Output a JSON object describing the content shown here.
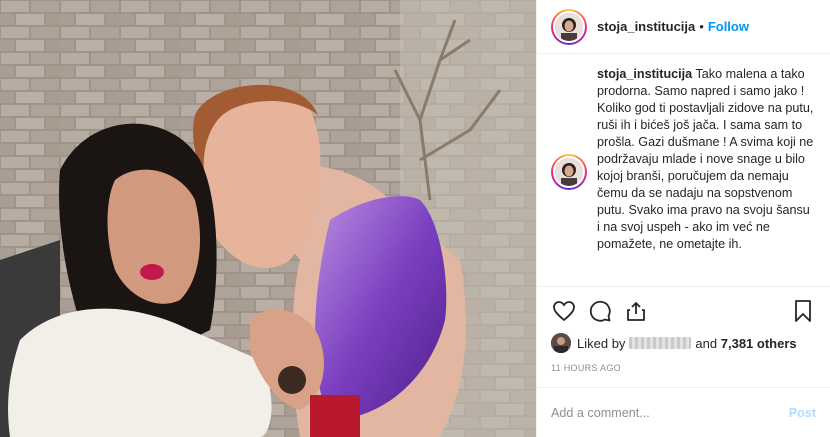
{
  "header": {
    "username": "stoja_institucija",
    "separator": "•",
    "follow_label": "Follow"
  },
  "caption": {
    "username": "stoja_institucija",
    "text": "Tako malena a tako prodorna. Samo napred i samo jako ! Koliko god ti postavljali zidove na putu, ruši ih i bićeš još jača. I sama sam to prošla. Gazi dušmane ! A svima koji ne podržavaju mlade i nove snage u bilo kojoj branši, poručujem da nemaju čemu da se nadaju na sopstvenom putu. Svako ima pravo na svoju šansu i na svoj uspeh - ako im već ne pomažete, ne ometajte ih."
  },
  "actions": {
    "icons": [
      "heart-icon",
      "comment-icon",
      "share-icon",
      "bookmark-icon"
    ]
  },
  "likes": {
    "prefix": "Liked by",
    "conjunction": "and",
    "count": "7,381 others"
  },
  "timestamp": "11 HOURS AGO",
  "comment_box": {
    "placeholder": "Add a comment...",
    "post_label": "Post"
  },
  "colors": {
    "link_blue": "#0095f6",
    "post_disabled": "#b3dbff",
    "secondary_text": "#8e8e8e"
  }
}
